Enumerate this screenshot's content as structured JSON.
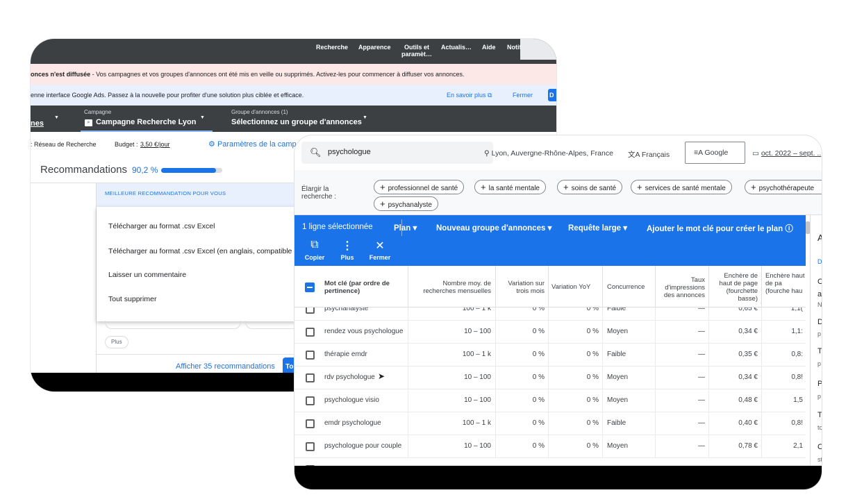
{
  "back": {
    "topnav": [
      "Recherche",
      "Apparence",
      "Outils et paramèt…",
      "Actualis…",
      "Aide",
      "Notif"
    ],
    "alert_bold": "onces n'est diffusée",
    "alert_text": " - Vos campagnes et vos groupes d'annonces ont été mis en veille ou supprimés. Activez-les pour commencer à diffuser vos annonces.",
    "info_text": "enne interface Google Ads. Passez à la nouvelle pour profiter d'une solution plus ciblée et efficace.",
    "info_learn": "En savoir plus",
    "info_close": "Fermer",
    "info_btn": "D",
    "crumb": {
      "left": "nes",
      "campaign_label": "Campagne",
      "campaign_value": "Campagne Recherche Lyon",
      "group_label": "Groupe d'annonces (1)",
      "group_value": "Sélectionnez un groupe d'annonces"
    },
    "network": ": Réseau de Recherche",
    "budget_label": "Budget :",
    "budget_value": "3,50 €/jour",
    "settings": "Paramètres de la campa",
    "rec_title": "Recommandations",
    "rec_score": "90,2 %",
    "rec_score_fraction": 0.902,
    "best_label": "MEILLEURE RECOMMANDATION POUR VOUS",
    "menu": [
      "Télécharger au format .csv Excel",
      "Télécharger au format .csv Excel (en anglais, compatible av",
      "Laisser un commentaire",
      "Tout supprimer"
    ],
    "plus_chip": "Plus",
    "show_all": "Afficher 35 recommandations",
    "show_btn": "To"
  },
  "front": {
    "query": "psychologue",
    "location": "Lyon, Auvergne-Rhône-Alpes, France",
    "language": "Français",
    "network": "Google",
    "dates": "oct. 2022 – sept. ..",
    "expand_label": "Élargir la recherche :",
    "chips": [
      "professionnel de santé",
      "la santé mentale",
      "soins de santé",
      "services de santé mentale",
      "psychothérapeute",
      "psychanalyste"
    ],
    "toolbar": {
      "selected": "1 ligne sélectionnée",
      "plan": "Plan",
      "new_group": "Nouveau groupe d'annonces",
      "match": "Requête large",
      "add": "Ajouter le mot clé pour créer le plan",
      "copy": "Copier",
      "more": "Plus",
      "close": "Fermer"
    },
    "headers": {
      "keyword": "Mot clé (par ordre de pertinence)",
      "avg": "Nombre moy. de recherches mensuelles",
      "three": "Variation sur trois mois",
      "yoy": "Variation YoY",
      "comp": "Concurrence",
      "impr": "Taux d'impressions des annonces",
      "low": "Enchère de haut de page (fourchette basse)",
      "high": "Enchère haut de pa (fourche hau"
    },
    "rows": [
      {
        "kw": "psychanalyste",
        "avg": "100 – 1 k",
        "three": "0 %",
        "yoy": "0 %",
        "comp": "Faible",
        "impr": "—",
        "low": "0,65 €",
        "high": "1,1("
      },
      {
        "kw": "rendez vous psychologue",
        "avg": "10 – 100",
        "three": "0 %",
        "yoy": "0 %",
        "comp": "Moyen",
        "impr": "—",
        "low": "0,34 €",
        "high": "1,1:"
      },
      {
        "kw": "thérapie emdr",
        "avg": "100 – 1 k",
        "three": "0 %",
        "yoy": "0 %",
        "comp": "Faible",
        "impr": "—",
        "low": "0,35 €",
        "high": "0,8:"
      },
      {
        "kw": "rdv psychologue",
        "avg": "10 – 100",
        "three": "0 %",
        "yoy": "0 %",
        "comp": "Moyen",
        "impr": "—",
        "low": "0,34 €",
        "high": "0,8!"
      },
      {
        "kw": "psychologue visio",
        "avg": "10 – 100",
        "three": "0 %",
        "yoy": "0 %",
        "comp": "Moyen",
        "impr": "—",
        "low": "0,48 €",
        "high": "1,5"
      },
      {
        "kw": "emdr psychologue",
        "avg": "100 – 1 k",
        "three": "0 %",
        "yoy": "0 %",
        "comp": "Faible",
        "impr": "—",
        "low": "0,40 €",
        "high": "0,8!"
      },
      {
        "kw": "psychologue pour couple",
        "avg": "10 – 100",
        "three": "0 %",
        "yoy": "0 %",
        "comp": "Moyen",
        "impr": "—",
        "low": "0,78 €",
        "high": "2,1"
      }
    ],
    "side_letters": [
      "A",
      "D",
      "C",
      "a",
      "N",
      "D",
      "p",
      "T",
      "p",
      "P",
      "p",
      "T",
      "tc",
      "C",
      "st"
    ]
  },
  "colors": {
    "accent": "#1a73e8",
    "dark": "#3c4043",
    "alert": "#fce8e6",
    "info": "#e8f0fe"
  }
}
